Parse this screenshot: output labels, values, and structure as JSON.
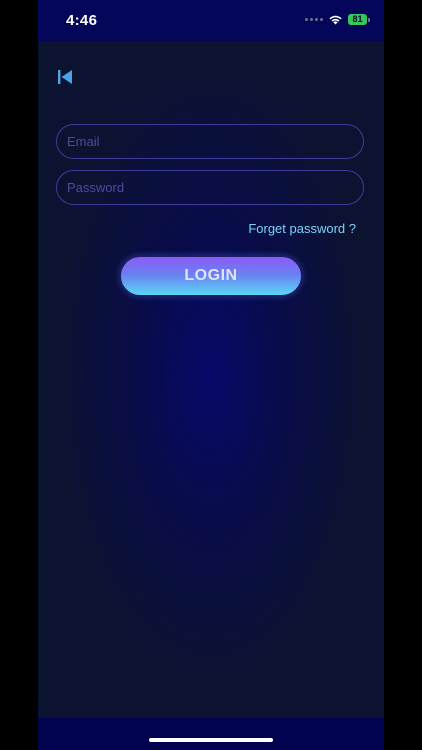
{
  "status_bar": {
    "time": "4:46",
    "battery_level": "81",
    "battery_color": "#35c759"
  },
  "header": {
    "back_icon": "skip-back-icon"
  },
  "form": {
    "email_placeholder": "Email",
    "email_value": "",
    "password_placeholder": "Password",
    "password_value": "",
    "forgot_label": "Forget password ?",
    "login_label": "LOGIN"
  },
  "colors": {
    "accent_link": "#7fd3f5",
    "button_top": "#8b5cf6",
    "button_bottom": "#5ad6f5",
    "field_border": "#3f3b9a"
  }
}
